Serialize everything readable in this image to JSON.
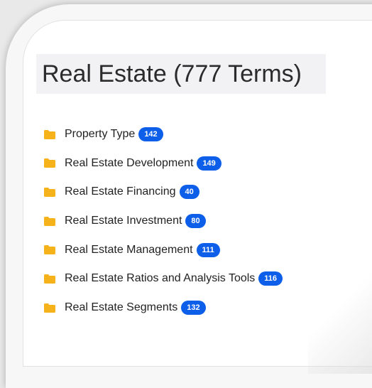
{
  "page": {
    "title": "Real Estate (777 Terms)"
  },
  "categories": [
    {
      "label": "Property Type",
      "count": "142"
    },
    {
      "label": "Real Estate Development",
      "count": "149"
    },
    {
      "label": "Real Estate Financing",
      "count": "40"
    },
    {
      "label": "Real Estate Investment",
      "count": "80"
    },
    {
      "label": "Real Estate Management",
      "count": "111"
    },
    {
      "label": "Real Estate Ratios and Analysis Tools",
      "count": "116"
    },
    {
      "label": "Real Estate Segments",
      "count": "132"
    }
  ],
  "colors": {
    "badge": "#0d5ee8",
    "folder": "#f6b21b",
    "title_bg": "#f2f2f4"
  },
  "icons": {
    "category": "folder-icon"
  }
}
